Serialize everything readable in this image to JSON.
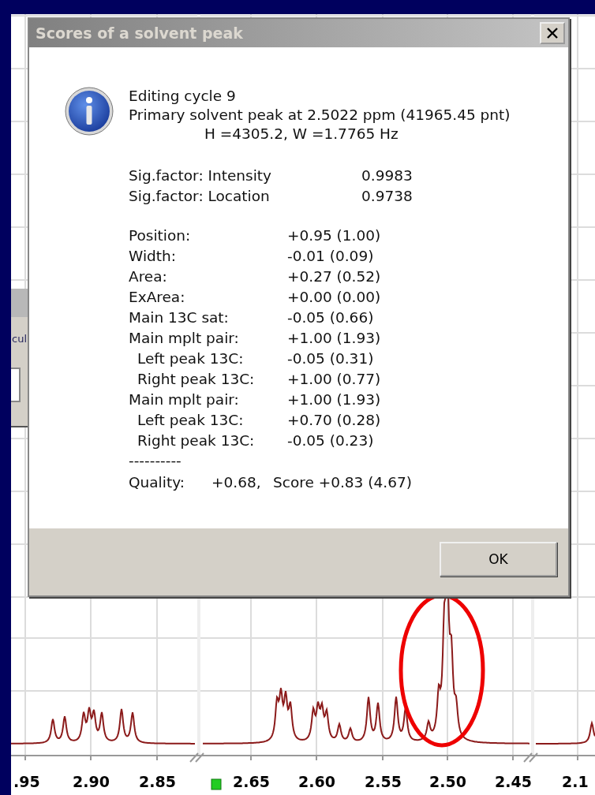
{
  "dialog": {
    "title": "Scores of a solvent peak",
    "header_lines": [
      "Editing cycle 9",
      "Primary solvent peak at 2.5022 ppm (41965.45 pnt)",
      "H =4305.2, W =1.7765 Hz"
    ],
    "sig_factors": [
      {
        "label": "Sig.factor: Intensity",
        "value": "0.9983"
      },
      {
        "label": "Sig.factor: Location",
        "value": "0.9738"
      }
    ],
    "scores": [
      {
        "label": "Position:",
        "value": "+0.95 (1.00)"
      },
      {
        "label": "Width:",
        "value": "-0.01 (0.09)"
      },
      {
        "label": "Area:",
        "value": "+0.27 (0.52)"
      },
      {
        "label": "ExArea:",
        "value": "+0.00 (0.00)"
      },
      {
        "label": "Main 13C sat:",
        "value": "-0.05 (0.66)"
      },
      {
        "label": "Main mplt pair:",
        "value": "+1.00 (1.93)",
        "children": [
          {
            "label": "Left peak 13C:",
            "value": "-0.05 (0.31)"
          },
          {
            "label": "Right peak 13C:",
            "value": "+1.00 (0.77)"
          }
        ]
      },
      {
        "label": "Main mplt pair:",
        "value": "+1.00 (1.93)",
        "children": [
          {
            "label": "Left peak 13C:",
            "value": "+0.70 (0.28)"
          },
          {
            "label": "Right peak 13C:",
            "value": "-0.05 (0.23)"
          }
        ]
      }
    ],
    "separator": "----------",
    "quality": {
      "label": "Quality:",
      "value": "+0.68,",
      "score": "Score +0.83 (4.67)"
    },
    "buttons": [
      "OK"
    ]
  },
  "background_dialog": {
    "text": "cul"
  },
  "spectrum": {
    "tick_labels": [
      ".95",
      "2.90",
      "2.85",
      "2.65",
      "2.60",
      "2.55",
      "2.50",
      "2.45",
      "2.1"
    ]
  }
}
